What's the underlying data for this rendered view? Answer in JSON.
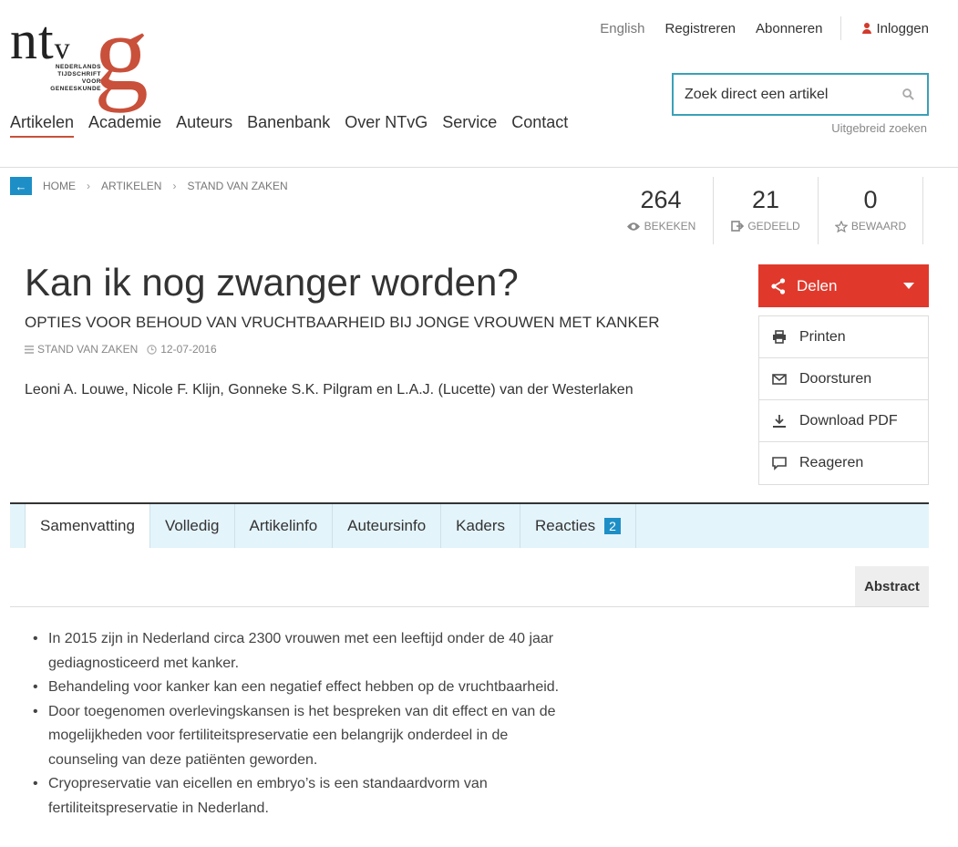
{
  "brand": {
    "logo_letters": "ntv",
    "logo_small": "v",
    "logo_g": "g",
    "tagline": "NEDERLANDS TIJDSCHRIFT VOOR GENEESKUNDE"
  },
  "topnav": {
    "english": "English",
    "register": "Registreren",
    "subscribe": "Abonneren",
    "login": "Inloggen"
  },
  "search": {
    "placeholder": "Zoek direct een artikel",
    "advanced": "Uitgebreid zoeken"
  },
  "mainnav": [
    "Artikelen",
    "Academie",
    "Auteurs",
    "Banenbank",
    "Over NTvG",
    "Service",
    "Contact"
  ],
  "breadcrumb": [
    "HOME",
    "ARTIKELEN",
    "STAND VAN ZAKEN"
  ],
  "stats": [
    {
      "value": "264",
      "label": "BEKEKEN",
      "icon": "eye-icon"
    },
    {
      "value": "21",
      "label": "GEDEELD",
      "icon": "share-out-icon"
    },
    {
      "value": "0",
      "label": "BEWAARD",
      "icon": "star-icon"
    }
  ],
  "article": {
    "title": "Kan ik nog zwanger worden?",
    "subtitle": "OPTIES VOOR BEHOUD VAN VRUCHTBAARHEID BIJ JONGE VROUWEN MET KANKER",
    "category": "STAND VAN ZAKEN",
    "date": "12-07-2016",
    "authors": "Leoni A. Louwe, Nicole F. Klijn, Gonneke S.K. Pilgram en L.A.J. (Lucette) van der Westerlaken"
  },
  "share": {
    "delen": "Delen",
    "actions": [
      "Printen",
      "Doorsturen",
      "Download PDF",
      "Reageren"
    ]
  },
  "tabs": [
    {
      "label": "Samenvatting"
    },
    {
      "label": "Volledig"
    },
    {
      "label": "Artikelinfo"
    },
    {
      "label": "Auteursinfo"
    },
    {
      "label": "Kaders"
    },
    {
      "label": "Reacties",
      "badge": "2"
    }
  ],
  "abstract_label": "Abstract",
  "bullets": [
    "In 2015 zijn in Nederland circa 2300 vrouwen met een leeftijd onder de 40 jaar gediagnosticeerd met kanker.",
    "Behandeling voor kanker kan een negatief effect hebben op de vruchtbaarheid.",
    "Door toegenomen overlevingskansen is het bespreken van dit effect en van de mogelijkheden voor fertiliteitspreservatie een belangrijk onderdeel in de counseling van deze patiënten geworden.",
    "Cryopreservatie van eicellen en embryo’s is een standaardvorm van fertiliteitspreservatie in Nederland."
  ],
  "colors": {
    "accent": "#c9503a",
    "share_red": "#e0392c",
    "link_blue": "#1e8fc6",
    "tab_bg": "#e4f4fb"
  }
}
